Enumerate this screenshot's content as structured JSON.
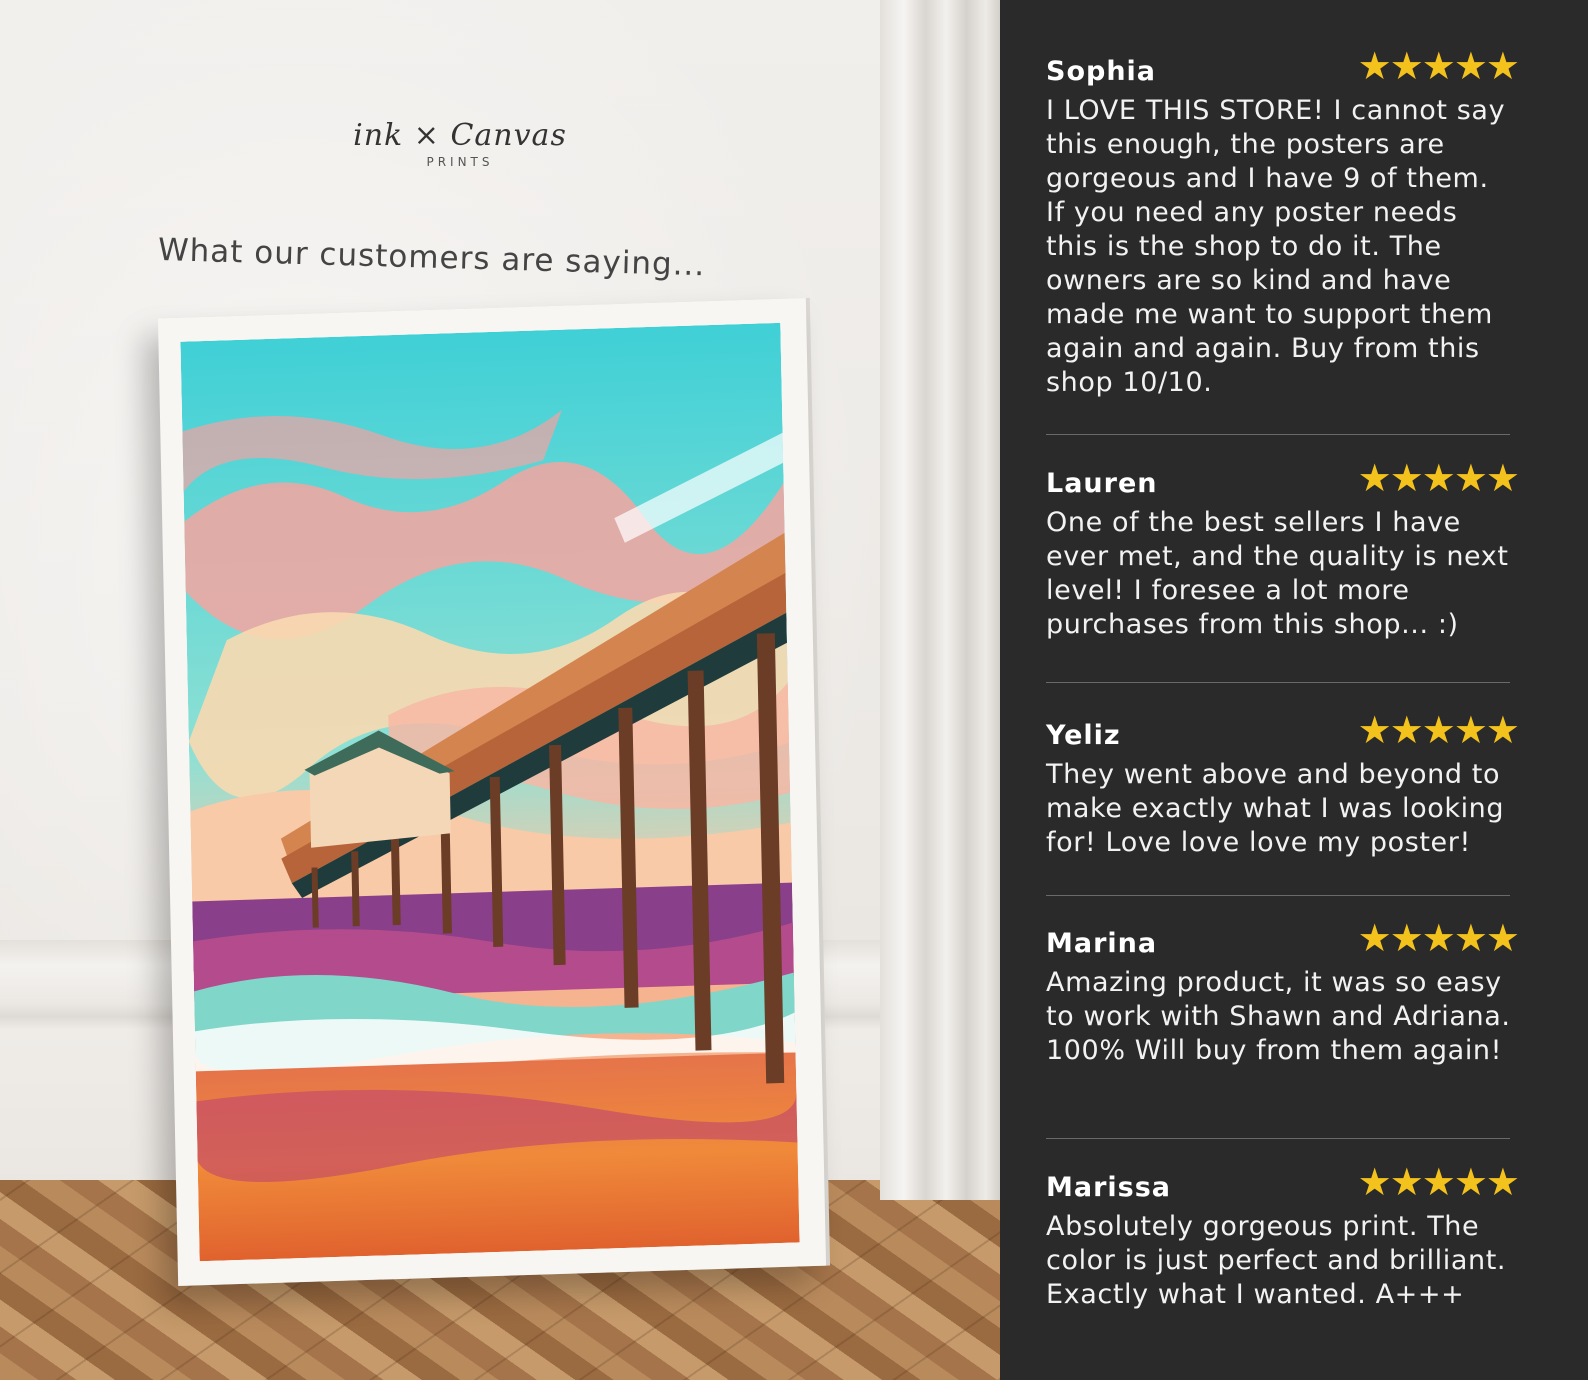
{
  "brand": {
    "logo_text": "ink × Canvas",
    "logo_sub": "PRINTS"
  },
  "headline": "What our customers are saying...",
  "colors": {
    "panel_bg": "#2a2a2a",
    "star": "#f4c21c",
    "text": "#f2f2f2"
  },
  "reviews": [
    {
      "name": "Sophia",
      "stars": "★★★★★",
      "rating": 5,
      "text": "I LOVE THIS STORE! I cannot say this enough, the posters are gorgeous and I have 9 of them. If you need any poster needs this is the shop to do it. The owners are so kind and have made me want to support them again and again. Buy from this shop 10/10."
    },
    {
      "name": "Lauren",
      "stars": "★★★★★",
      "rating": 5,
      "text": "One of the best sellers I have ever met, and the quality is next level! I foresee a lot more purchases from this shop... :)"
    },
    {
      "name": "Yeliz",
      "stars": "★★★★★",
      "rating": 5,
      "text": "They went above and beyond to make exactly what I was looking for! Love love love my poster!"
    },
    {
      "name": "Marina",
      "stars": "★★★★★",
      "rating": 5,
      "text": "Amazing product, it was so easy to work with Shawn and Adriana. 100% Will buy from them again!"
    },
    {
      "name": "Marissa",
      "stars": "★★★★★",
      "rating": 5,
      "text": "Absolutely gorgeous print. The color is just perfect and brilliant. Exactly what I wanted. A+++"
    }
  ]
}
